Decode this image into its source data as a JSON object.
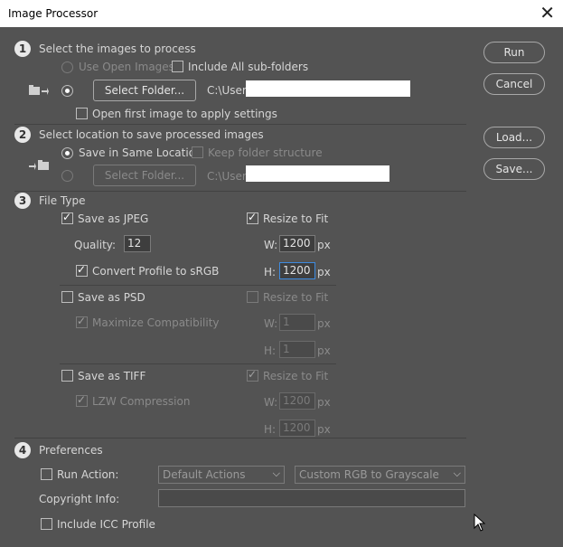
{
  "window": {
    "title": "Image Processor",
    "close_glyph": "✕"
  },
  "sections": {
    "s1": {
      "number": "1",
      "title": "Select the images to process",
      "use_open_images": "Use Open Images",
      "include_subfolders": "Include All sub-folders",
      "select_folder": "Select Folder...",
      "path_prefix": "C:\\Users\\",
      "open_first": "Open first image to apply settings"
    },
    "s2": {
      "number": "2",
      "title": "Select location to save processed images",
      "save_same": "Save in Same Location",
      "keep_structure": "Keep folder structure",
      "select_folder": "Select Folder...",
      "path_prefix": "C:\\Users"
    },
    "s3": {
      "number": "3",
      "title": "File Type",
      "jpeg": {
        "label": "Save as JPEG",
        "resize": "Resize to Fit",
        "quality_label": "Quality:",
        "quality_value": "12",
        "w_label": "W:",
        "w_value": "1200",
        "h_label": "H:",
        "h_value": "1200",
        "px": "px",
        "convert": "Convert Profile to sRGB"
      },
      "psd": {
        "label": "Save as PSD",
        "resize": "Resize to Fit",
        "maximize": "Maximize Compatibility",
        "w_label": "W:",
        "w_value": "1",
        "h_label": "H:",
        "h_value": "1",
        "px": "px"
      },
      "tiff": {
        "label": "Save as TIFF",
        "resize": "Resize to Fit",
        "lzw": "LZW Compression",
        "w_label": "W:",
        "w_value": "1200",
        "h_label": "H:",
        "h_value": "1200",
        "px": "px"
      }
    },
    "s4": {
      "number": "4",
      "title": "Preferences",
      "run_action": "Run Action:",
      "action_set": "Default Actions",
      "action": "Custom RGB to Grayscale",
      "copyright": "Copyright Info:",
      "copyright_value": "",
      "icc": "Include ICC Profile"
    }
  },
  "side_buttons": {
    "run": "Run",
    "cancel": "Cancel",
    "load": "Load...",
    "save": "Save..."
  },
  "icons": {
    "chevron": "⌵"
  }
}
